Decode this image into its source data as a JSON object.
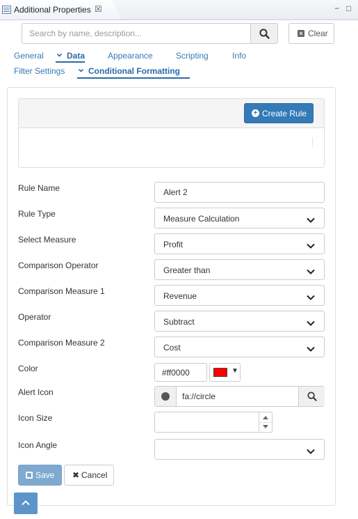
{
  "window": {
    "tab_title": "Additional Properties",
    "close_glyph": "☒",
    "minimize_glyph": "−",
    "maximize_glyph": "□"
  },
  "search": {
    "placeholder": "Search by name, description...",
    "value": "",
    "clear_label": "Clear"
  },
  "tabs": {
    "general": "General",
    "data": "Data",
    "appearance": "Appearance",
    "scripting": "Scripting",
    "info": "Info",
    "filter_settings": "Filter Settings",
    "conditional_formatting": "Conditional Formatting"
  },
  "rules": {
    "create_label": "Create Rule"
  },
  "form": {
    "rule_name": {
      "label": "Rule Name",
      "value": "Alert 2"
    },
    "rule_type": {
      "label": "Rule Type",
      "value": "Measure Calculation"
    },
    "select_measure": {
      "label": "Select Measure",
      "value": "Profit"
    },
    "comparison_operator": {
      "label": "Comparison Operator",
      "value": "Greater than"
    },
    "comparison_measure_1": {
      "label": "Comparison Measure 1",
      "value": "Revenue"
    },
    "operator": {
      "label": "Operator",
      "value": "Subtract"
    },
    "comparison_measure_2": {
      "label": "Comparison Measure 2",
      "value": "Cost"
    },
    "color": {
      "label": "Color",
      "value": "#ff0000",
      "swatch": "#ff0000"
    },
    "alert_icon": {
      "label": "Alert Icon",
      "value": "fa://circle",
      "icon": "circle-icon"
    },
    "icon_size": {
      "label": "Icon Size",
      "value": ""
    },
    "icon_angle": {
      "label": "Icon Angle",
      "value": ""
    }
  },
  "actions": {
    "save_label": "Save",
    "cancel_label": "Cancel"
  },
  "colors": {
    "primary": "#337ab7",
    "tab_active": "#2a6aa8",
    "save_disabled": "#7fa9cf",
    "scroll_top": "#5b95c9"
  }
}
